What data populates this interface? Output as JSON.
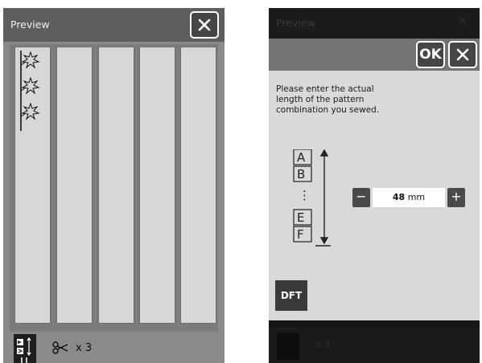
{
  "left_screen": {
    "title": "Preview",
    "close_icon": "close-icon",
    "columns": 5,
    "stitch_icon": "star-stitch-pattern-icon",
    "repeat_icon": "scissors-repeat-icon",
    "repeat_count": "x 3",
    "mirror_icon": "mirror-pattern-icon"
  },
  "right_screen": {
    "background_title": "Preview",
    "background_repeat": "x 3",
    "dialog": {
      "ok_label": "OK",
      "instruction": "Please enter the actual length of the pattern combination you sewed.",
      "pattern_letters": [
        "A",
        "B",
        "E",
        "F"
      ],
      "ellipsis": "⋮",
      "measure_icon": "vertical-length-arrow-icon",
      "stepper": {
        "minus_label": "−",
        "plus_label": "+",
        "value": "48",
        "unit": "mm"
      },
      "default_label": "DFT"
    }
  },
  "colors": {
    "title_bar": "#5e5e5e",
    "panel": "#8a8a8a",
    "column_fill": "#d7d7d7",
    "dialog_fill": "#d9d9d9",
    "button_dark": "#454545"
  }
}
